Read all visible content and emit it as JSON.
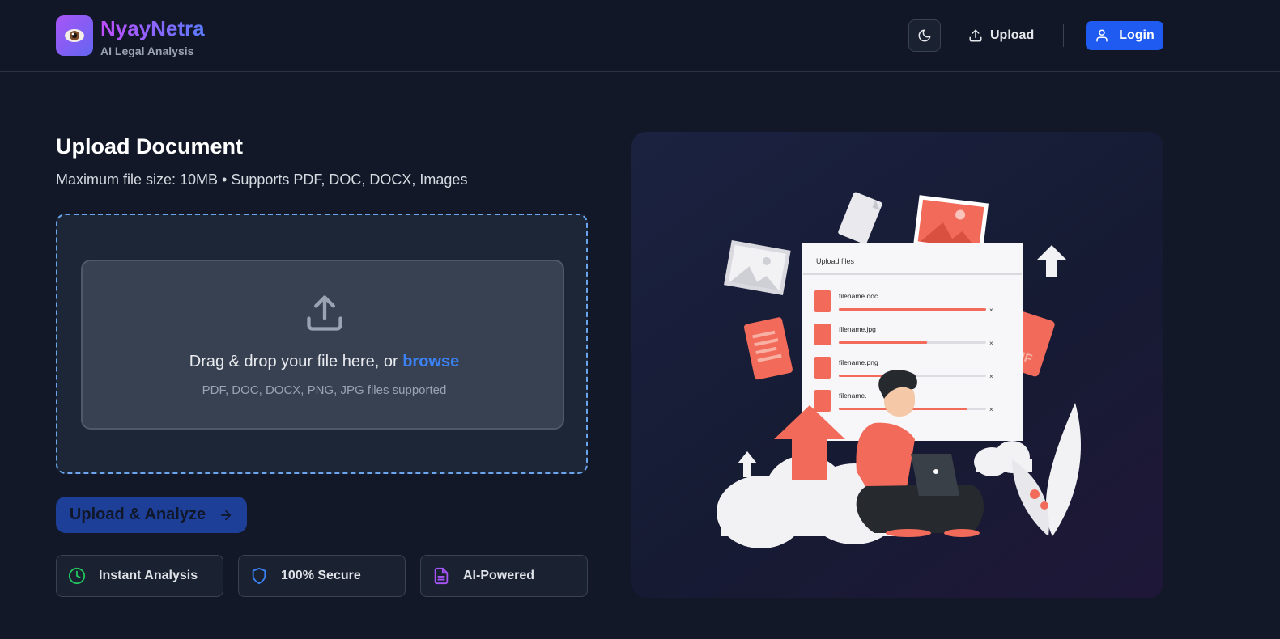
{
  "header": {
    "brand_name": "NyayNetra",
    "brand_tagline": "AI Legal Analysis",
    "upload_label": "Upload",
    "login_label": "Login",
    "icons": {
      "logo": "eye-icon",
      "theme": "moon-icon",
      "upload": "upload-icon",
      "login": "user-icon"
    }
  },
  "upload_section": {
    "title": "Upload Document",
    "subtitle": "Maximum file size: 10MB • Supports PDF, DOC, DOCX, Images",
    "dropzone": {
      "prompt": "Drag & drop your file here, or ",
      "browse_label": "browse",
      "hint": "PDF, DOC, DOCX, PNG, JPG files supported"
    },
    "analyze_label": "Upload & Analyze"
  },
  "features": [
    {
      "label": "Instant Analysis",
      "icon": "clock-icon",
      "color": "#22c55e"
    },
    {
      "label": "100% Secure",
      "icon": "shield-icon",
      "color": "#3b82f6"
    },
    {
      "label": "AI-Powered",
      "icon": "document-icon",
      "color": "#a855f7"
    }
  ],
  "illustration": {
    "window_title": "Upload files",
    "files": [
      {
        "name": "filename.doc",
        "progress": 1.0
      },
      {
        "name": "filename.jpg",
        "progress": 0.6
      },
      {
        "name": "filename.png",
        "progress": 0.4
      },
      {
        "name": "filename.",
        "progress": 0.87
      }
    ],
    "gif_label": "GIF"
  },
  "colors": {
    "accent": "#1f5af1",
    "browse": "#3b82f6",
    "illustration_coral": "#f26b5a",
    "background": "#121827"
  }
}
